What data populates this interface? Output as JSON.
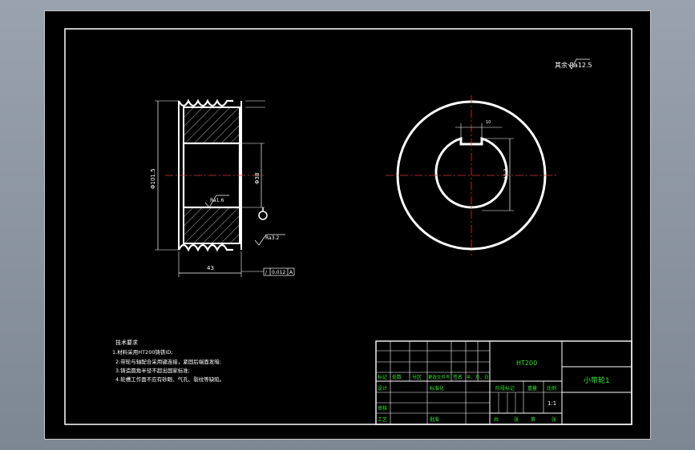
{
  "drawing": {
    "roughness_note": "其余 Ra12.5",
    "diameters": {
      "outer": "Φ101.5",
      "bore": "Φ38",
      "bore_label_prefix": "Φ",
      "keyway_width": "10",
      "keyway_depth": "41.3"
    },
    "surface_finish": {
      "bore": "Ra1.6",
      "groove": "Ra3.2",
      "face": "Ra12.5"
    },
    "width_dim": "43",
    "tolerance_frame": {
      "symbol": "/",
      "value": "0.012",
      "datum": "A"
    },
    "technical_requirements": {
      "heading": "技术要求",
      "items": [
        "1.材料采用HT200铸铁ID;",
        "2.带轮与轴配合采用键连接，紧固后端面发暗;",
        "3.铸造圆角半径不超出国家标准;",
        "4.轮槽工作面不应有砂眼、气孔、裂纹等缺陷。"
      ]
    },
    "title_block": {
      "material": "HT200",
      "part_name": "小带轮1",
      "scale": "1:1",
      "headers": [
        "标记",
        "处数",
        "分区",
        "更改文件号",
        "签名",
        "年、月、日"
      ],
      "roles": {
        "design": "设计",
        "standardize": "标准化",
        "review": "审核",
        "process": "工艺",
        "approve": "批准"
      },
      "stage_mark": "阶段标记",
      "weight": "重量",
      "ratio": "比例",
      "sheets": [
        "共",
        "张",
        "第",
        "张"
      ]
    }
  }
}
